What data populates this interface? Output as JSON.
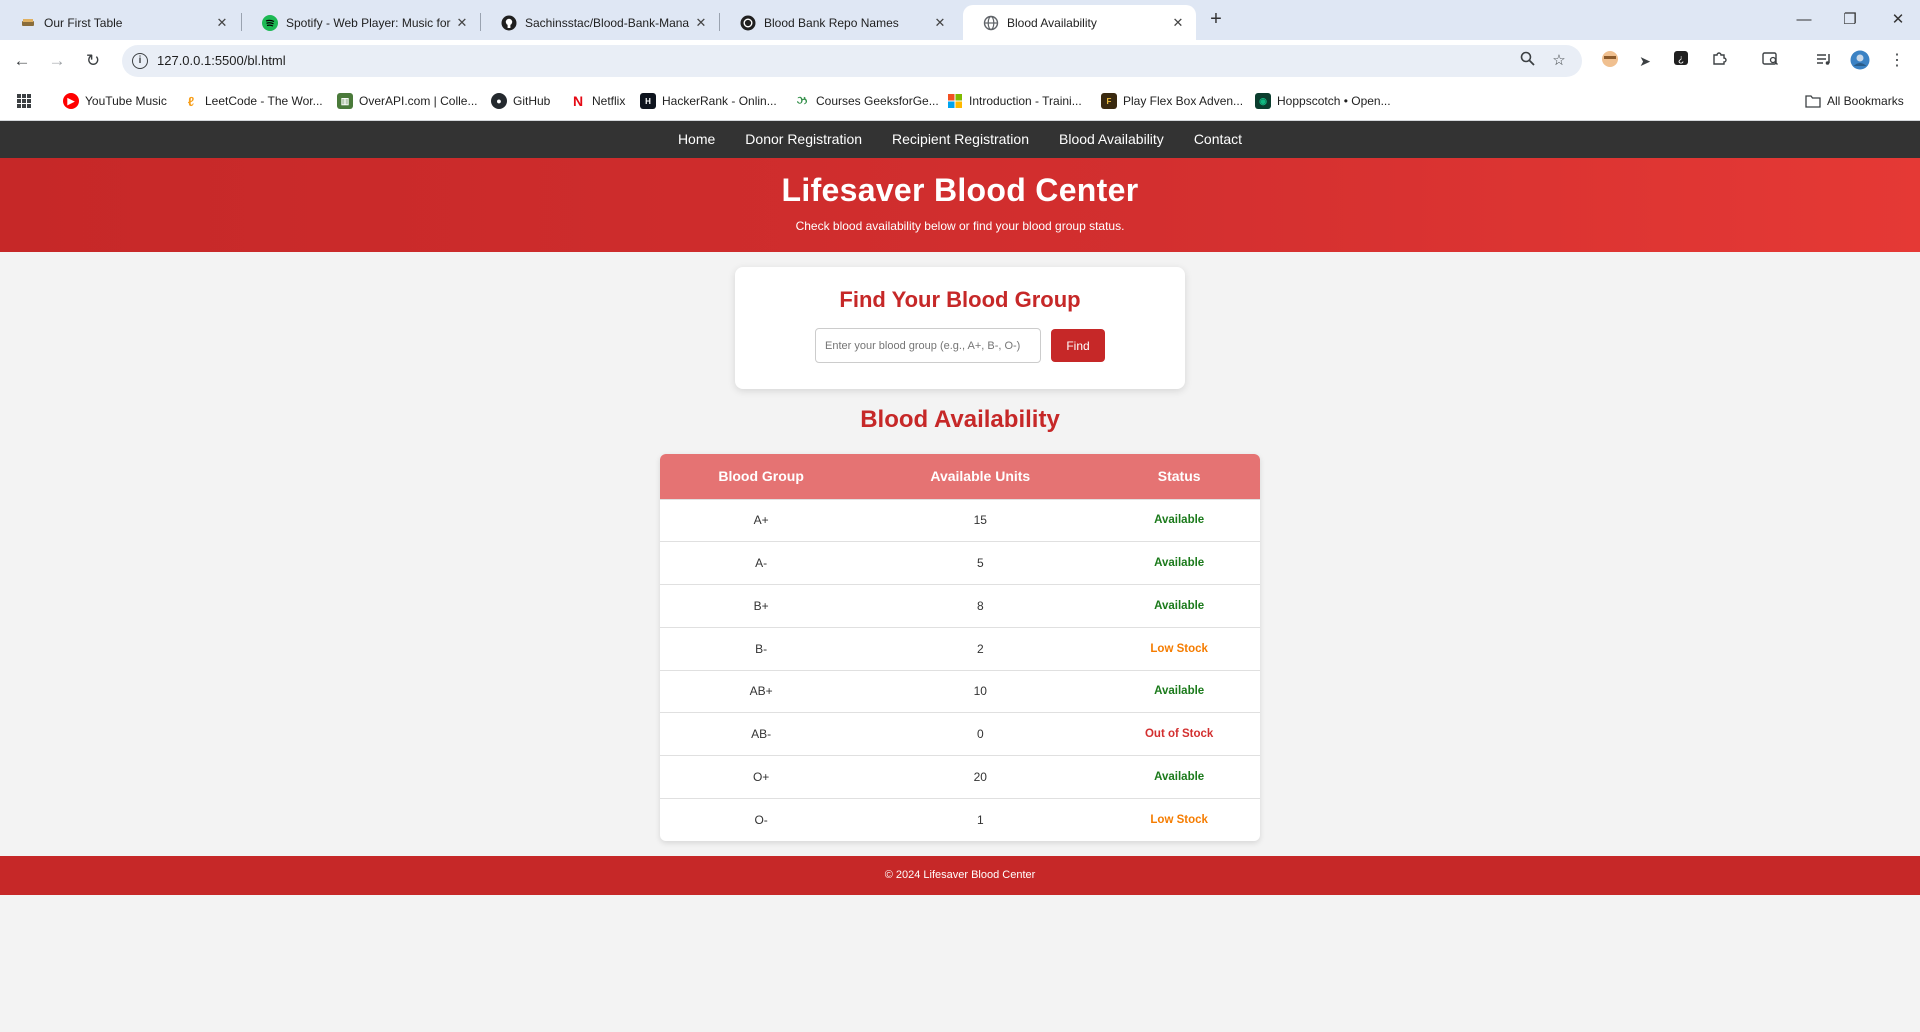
{
  "browser": {
    "tabs": [
      {
        "title": "Our First Table",
        "icon": "doc-icon",
        "active": false
      },
      {
        "title": "Spotify - Web Player: Music for",
        "icon": "spotify-icon",
        "active": false
      },
      {
        "title": "Sachinsstac/Blood-Bank-Mana",
        "icon": "github-icon",
        "active": false
      },
      {
        "title": "Blood Bank Repo Names",
        "icon": "openai-icon",
        "active": false
      },
      {
        "title": "Blood Availability",
        "icon": "globe-icon",
        "active": true
      }
    ],
    "url": "127.0.0.1:5500/bl.html",
    "bookmarks": [
      {
        "label": "YouTube Music",
        "icon": "youtube-music-icon",
        "color": "#ff0000"
      },
      {
        "label": "LeetCode - The Wor...",
        "icon": "leetcode-icon",
        "color": "#f89f1b"
      },
      {
        "label": "OverAPI.com | Colle...",
        "icon": "overapi-icon",
        "color": "#4a7a3a"
      },
      {
        "label": "GitHub",
        "icon": "github-icon",
        "color": "#24292e"
      },
      {
        "label": "Netflix",
        "icon": "netflix-icon",
        "color": "#e50914"
      },
      {
        "label": "HackerRank - Onlin...",
        "icon": "hackerrank-icon",
        "color": "#0e141e"
      },
      {
        "label": "Courses GeeksforGe...",
        "icon": "gfg-icon",
        "color": "#2f8d46"
      },
      {
        "label": "Introduction - Traini...",
        "icon": "microsoft-icon",
        "color": "#f25022"
      },
      {
        "label": "Play Flex Box Adven...",
        "icon": "flexbox-icon",
        "color": "#3a2a10"
      },
      {
        "label": "Hoppscotch • Open...",
        "icon": "hoppscotch-icon",
        "color": "#10b981"
      }
    ],
    "all_bookmarks": "All Bookmarks"
  },
  "nav": {
    "home": "Home",
    "donor": "Donor Registration",
    "recipient": "Recipient Registration",
    "availability": "Blood Availability",
    "contact": "Contact"
  },
  "hero": {
    "title": "Lifesaver Blood Center",
    "subtitle": "Check blood availability below or find your blood group status."
  },
  "find": {
    "title": "Find Your Blood Group",
    "placeholder": "Enter your blood group (e.g., A+, B-, O-)",
    "button": "Find"
  },
  "availability": {
    "title": "Blood Availability",
    "headers": [
      "Blood Group",
      "Available Units",
      "Status"
    ],
    "rows": [
      {
        "group": "A+",
        "units": "15",
        "status": "Available",
        "color": "#1b7a1b"
      },
      {
        "group": "A-",
        "units": "5",
        "status": "Available",
        "color": "#1b7a1b"
      },
      {
        "group": "B+",
        "units": "8",
        "status": "Available",
        "color": "#1b7a1b"
      },
      {
        "group": "B-",
        "units": "2",
        "status": "Low Stock",
        "color": "#f57c00"
      },
      {
        "group": "AB+",
        "units": "10",
        "status": "Available",
        "color": "#1b7a1b"
      },
      {
        "group": "AB-",
        "units": "0",
        "status": "Out of Stock",
        "color": "#d32f2f"
      },
      {
        "group": "O+",
        "units": "20",
        "status": "Available",
        "color": "#1b7a1b"
      },
      {
        "group": "O-",
        "units": "1",
        "status": "Low Stock",
        "color": "#f57c00"
      }
    ]
  },
  "footer": {
    "text": "© 2024 Lifesaver Blood Center"
  },
  "colors": {
    "brand_red": "#c62828",
    "header_row": "#e57373",
    "nav_bg": "#333333"
  }
}
